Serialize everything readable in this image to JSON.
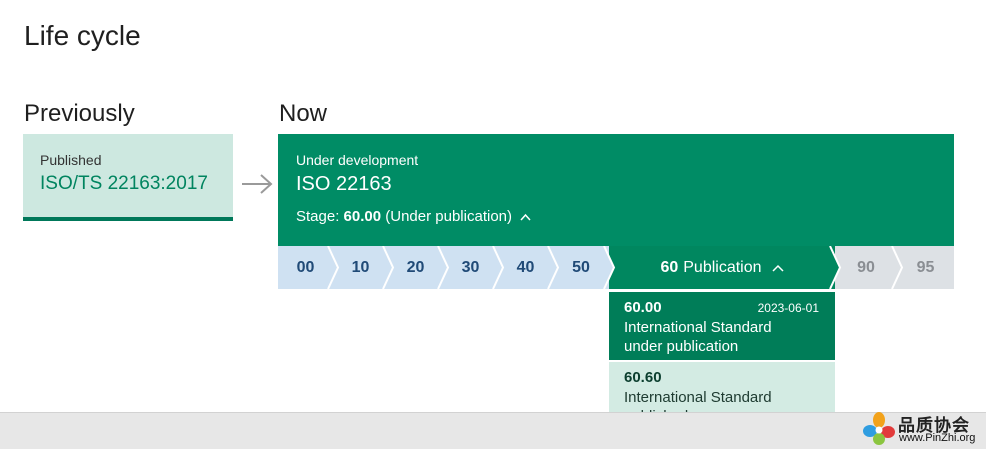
{
  "page_title": "Life cycle",
  "previously": {
    "heading": "Previously",
    "status": "Published",
    "reference": "ISO/TS 22163:2017"
  },
  "now": {
    "heading": "Now",
    "status": "Under development",
    "reference": "ISO 22163",
    "stage_prefix": "Stage:",
    "stage_code": "60.00",
    "stage_name": "(Under publication)"
  },
  "stages": [
    {
      "code": "00"
    },
    {
      "code": "10"
    },
    {
      "code": "20"
    },
    {
      "code": "30"
    },
    {
      "code": "40"
    },
    {
      "code": "50"
    },
    {
      "code": "60",
      "name": "Publication"
    },
    {
      "code": "90"
    },
    {
      "code": "95"
    }
  ],
  "substages": [
    {
      "code": "60.00",
      "date": "2023-06-01",
      "desc1": "International Standard",
      "desc2": "under publication"
    },
    {
      "code": "60.60",
      "desc1": "International Standard",
      "desc2": "published"
    }
  ],
  "watermark": {
    "name": "品质协会",
    "url": "www.PinZhi.org"
  },
  "colors": {
    "accent_green": "#008c65",
    "light_green": "#cde8e0",
    "stage_blue": "#cfe1f2",
    "stage_grey": "#dde1e5"
  }
}
